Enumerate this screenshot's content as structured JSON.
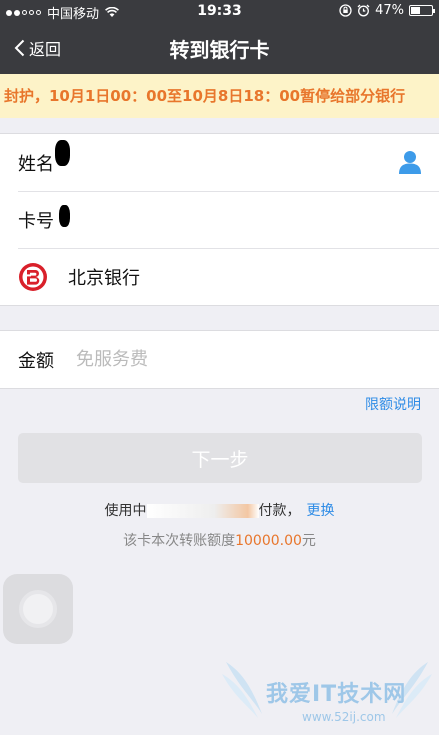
{
  "status_bar": {
    "carrier": "中国移动",
    "time": "19:33",
    "battery": "47%",
    "battery_level": 0.47,
    "signal_bars_filled": 2,
    "signal_bars_total": 5
  },
  "nav": {
    "back_label": "返回",
    "title": "转到银行卡"
  },
  "notice": {
    "text": "封护，10月1日00：00至10月8日18：00暂停给部分银行"
  },
  "recipient": {
    "name_label": "姓名",
    "card_label": "卡号",
    "bank_name": "北京银行"
  },
  "amount": {
    "label": "金额",
    "placeholder": "免服务费"
  },
  "limit_link": "限额说明",
  "next_button": "下一步",
  "payment": {
    "prefix": "使用中",
    "suffix": "付款，",
    "change_label": "更换",
    "quota_prefix": "该卡本次转账额度",
    "quota_amount": "10000.00",
    "quota_unit": "元"
  },
  "watermark": {
    "title": "我爱IT技术网",
    "url": "www.52ij.com"
  },
  "colors": {
    "nav_bg": "#3a3b3f",
    "notice_bg": "#fdf3c8",
    "notice_text": "#e8762c",
    "link": "#2f8ce6",
    "bank_red": "#d9202a"
  }
}
